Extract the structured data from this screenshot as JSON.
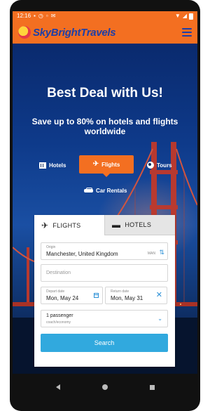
{
  "status_bar": {
    "time": "12:16",
    "icons": [
      "sim-icon",
      "clock-icon",
      "lock-icon",
      "mail-icon",
      "wifi-icon",
      "signal-icon",
      "battery-icon"
    ]
  },
  "app": {
    "logo_text": "SkyBrightTravels",
    "brand_color": "#f36f21",
    "logo_text_color": "#1d3fa8"
  },
  "hero": {
    "title": "Best Deal with Us!",
    "subtitle": "Save up to 80% on hotels and flights worldwide"
  },
  "categories": {
    "hotels": "Hotels",
    "flights": "Flights",
    "tours": "Tours",
    "car_rentals": "Car Rentals",
    "active": "flights"
  },
  "booking": {
    "tabs": {
      "flights": "FLIGHTS",
      "hotels": "HOTELS",
      "active": "flights"
    },
    "origin": {
      "label": "Origin",
      "value": "Manchester, United Kingdom",
      "code": "MAN"
    },
    "destination": {
      "placeholder": "Destination"
    },
    "depart": {
      "label": "Depart date",
      "value": "Mon, May 24"
    },
    "return": {
      "label": "Return date",
      "value": "Mon, May 31"
    },
    "passengers": {
      "value": "1 passenger",
      "cabin": "coach/economy"
    },
    "search_label": "Search",
    "search_color": "#31a9de"
  }
}
